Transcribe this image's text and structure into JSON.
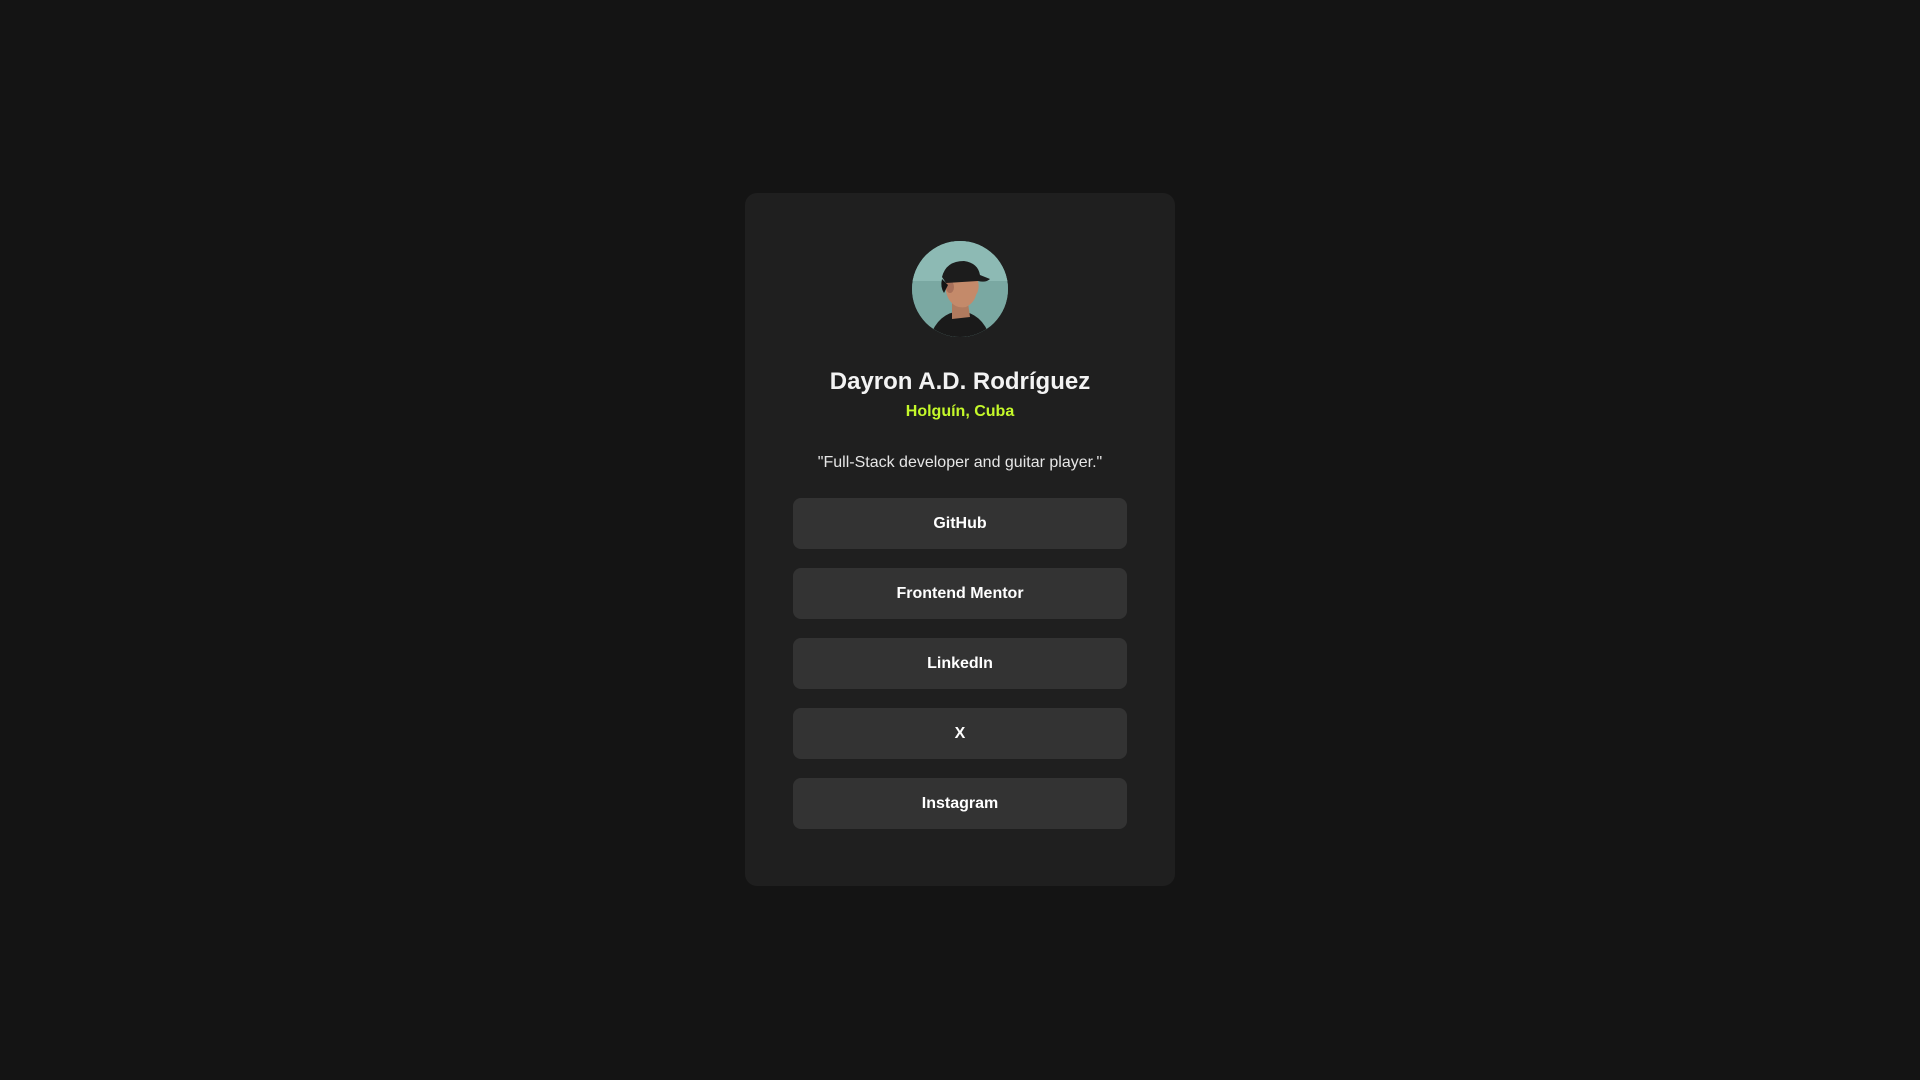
{
  "profile": {
    "name": "Dayron A.D. Rodríguez",
    "location": "Holguín, Cuba",
    "bio": "\"Full-Stack developer and guitar player.\"",
    "avatar_icon": "profile-photo"
  },
  "links": [
    {
      "label": "GitHub"
    },
    {
      "label": "Frontend Mentor"
    },
    {
      "label": "LinkedIn"
    },
    {
      "label": "X"
    },
    {
      "label": "Instagram"
    }
  ],
  "colors": {
    "page_background": "#141414",
    "card_background": "#1f1f1f",
    "button_background": "#333333",
    "accent": "#c4f82a",
    "text": "#ffffff"
  }
}
